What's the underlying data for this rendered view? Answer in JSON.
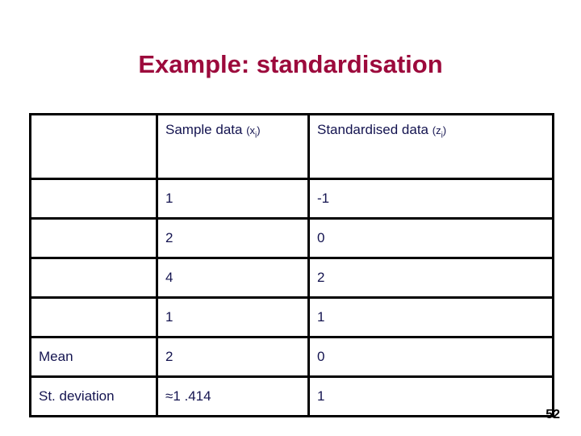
{
  "slide": {
    "title": "Example: standardisation",
    "page_number": "52",
    "title_color": "#9c0a3c",
    "text_color": "#141450",
    "border_color": "#000000",
    "background": "#ffffff"
  },
  "table": {
    "corner_label": "",
    "headers": {
      "row_label": "",
      "sample": {
        "text": "Sample data ",
        "paren_open": "(",
        "symbol": "x",
        "subscript": "i",
        "paren_close": ")"
      },
      "standardised": {
        "text": "Standardised data ",
        "paren_open": "(",
        "symbol": "z",
        "subscript": "i",
        "paren_close": ")"
      }
    },
    "rows": [
      {
        "label": "",
        "sample": "1",
        "standardised": "-1",
        "small": false
      },
      {
        "label": "",
        "sample": "2",
        "standardised": "0",
        "small": false
      },
      {
        "label": "",
        "sample": "4",
        "standardised": "2",
        "small": false
      },
      {
        "label": "",
        "sample": "1",
        "standardised": "1",
        "small": false
      },
      {
        "label": "Mean",
        "sample": "2",
        "standardised": "0",
        "small": false
      },
      {
        "label": "St. deviation",
        "sample": "≈1 .414",
        "standardised": "1",
        "small": true
      }
    ]
  }
}
